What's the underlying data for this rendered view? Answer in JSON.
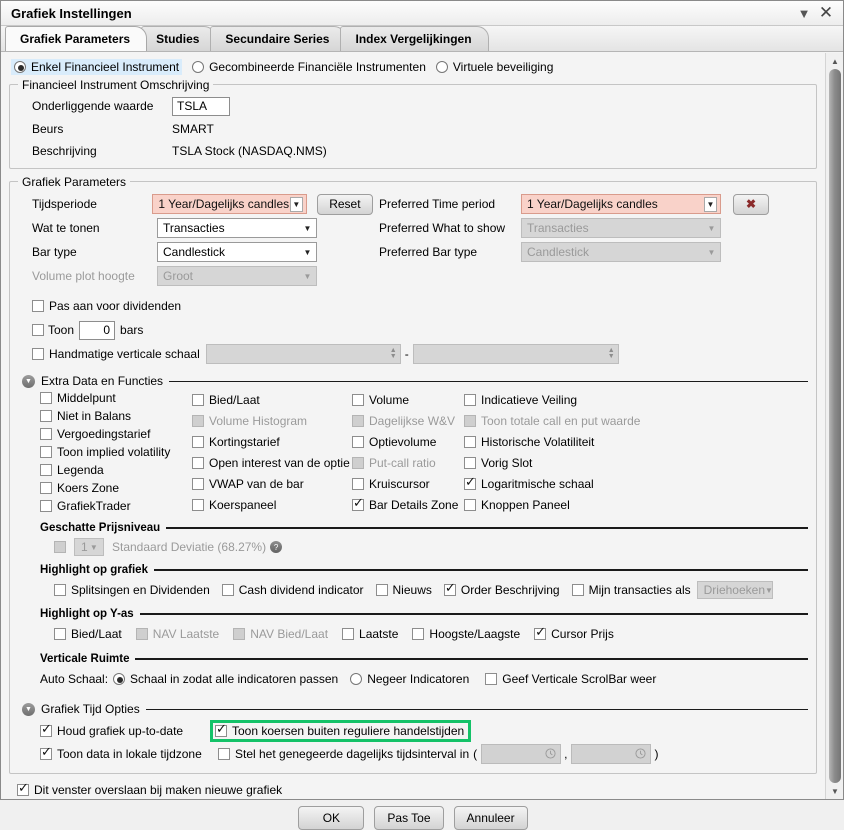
{
  "window": {
    "title": "Grafiek Instellingen",
    "minimize_icon": "chevron-down-icon",
    "close_icon": "close-icon"
  },
  "tabs": [
    {
      "label": "Grafiek Parameters",
      "active": true
    },
    {
      "label": "Studies",
      "active": false
    },
    {
      "label": "Secundaire Series",
      "active": false
    },
    {
      "label": "Index Vergelijkingen",
      "active": false
    }
  ],
  "instrument_mode": {
    "options": [
      {
        "label": "Enkel Financieel Instrument",
        "selected": true
      },
      {
        "label": "Gecombineerde Financiële Instrumenten",
        "selected": false
      },
      {
        "label": "Virtuele beveiliging",
        "selected": false
      }
    ]
  },
  "instrument_group": {
    "title": "Financieel Instrument Omschrijving",
    "underlying_label": "Onderliggende waarde",
    "underlying_value": "TSLA",
    "exchange_label": "Beurs",
    "exchange_value": "SMART",
    "description_label": "Beschrijving",
    "description_value": "TSLA Stock (NASDAQ.NMS)"
  },
  "chart_params": {
    "title": "Grafiek Parameters",
    "timeperiod_label": "Tijdsperiode",
    "timeperiod_value": "1 Year/Dagelijks candles",
    "reset_label": "Reset",
    "whattoshow_label": "Wat te tonen",
    "whattoshow_value": "Transacties",
    "bartype_label": "Bar type",
    "bartype_value": "Candlestick",
    "volumeheight_label": "Volume plot hoogte",
    "volumeheight_value": "Groot",
    "preferred_timeperiod_label": "Preferred Time period",
    "preferred_timeperiod_value": "1 Year/Dagelijks candles",
    "clear_preferred_icon": "x-icon",
    "preferred_whattoshow_label": "Preferred What to show",
    "preferred_whattoshow_value": "Transacties",
    "preferred_bartype_label": "Preferred Bar type",
    "preferred_bartype_value": "Candlestick",
    "adjust_dividends_label": "Pas aan voor dividenden",
    "show_bars_prefix": "Toon",
    "show_bars_value": "0",
    "show_bars_suffix": "bars",
    "manual_scale_label": "Handmatige verticale schaal",
    "manual_scale_separator": "-"
  },
  "extra_data": {
    "title": "Extra Data en Functies",
    "collapse_icon": "chevron-down-circle-icon",
    "columns": [
      [
        {
          "label": "Middelpunt",
          "checked": false,
          "disabled": false
        },
        {
          "label": "Niet in Balans",
          "checked": false,
          "disabled": false
        },
        {
          "label": "Vergoedingstarief",
          "checked": false,
          "disabled": false
        },
        {
          "label": "Toon implied volatility",
          "checked": false,
          "disabled": false
        },
        {
          "label": "Legenda",
          "checked": false,
          "disabled": false
        },
        {
          "label": "Koers Zone",
          "checked": false,
          "disabled": false
        },
        {
          "label": "GrafiekTrader",
          "checked": false,
          "disabled": false
        }
      ],
      [
        {
          "label": "Bied/Laat",
          "checked": false,
          "disabled": false
        },
        {
          "label": "Volume Histogram",
          "checked": false,
          "disabled": true
        },
        {
          "label": "Kortingstarief",
          "checked": false,
          "disabled": false
        },
        {
          "label": "Open interest van de optie",
          "checked": false,
          "disabled": false
        },
        {
          "label": "VWAP van de bar",
          "checked": false,
          "disabled": false
        },
        {
          "label": "Koerspaneel",
          "checked": false,
          "disabled": false
        }
      ],
      [
        {
          "label": "Volume",
          "checked": false,
          "disabled": false
        },
        {
          "label": "Dagelijkse W&V",
          "checked": false,
          "disabled": true
        },
        {
          "label": "Optievolume",
          "checked": false,
          "disabled": false
        },
        {
          "label": "Put-call ratio",
          "checked": false,
          "disabled": true
        },
        {
          "label": "Kruiscursor",
          "checked": false,
          "disabled": false
        },
        {
          "label": "Bar Details Zone",
          "checked": true,
          "disabled": false
        }
      ],
      [
        {
          "label": "Indicatieve Veiling",
          "checked": false,
          "disabled": false
        },
        {
          "label": "Toon totale call en put waarde",
          "checked": false,
          "disabled": true
        },
        {
          "label": "Historische Volatiliteit",
          "checked": false,
          "disabled": false
        },
        {
          "label": "Vorig Slot",
          "checked": false,
          "disabled": false
        },
        {
          "label": "Logaritmische schaal",
          "checked": true,
          "disabled": false
        },
        {
          "label": "Knoppen Paneel",
          "checked": false,
          "disabled": false
        }
      ]
    ]
  },
  "price_level": {
    "title": "Geschatte Prijsniveau",
    "multiplier": "1",
    "label": "Standaard Deviatie (68.27%)",
    "help_icon": "help-icon"
  },
  "highlight_chart": {
    "title": "Highlight op grafiek",
    "items": [
      {
        "label": "Splitsingen en Dividenden",
        "checked": false,
        "disabled": false
      },
      {
        "label": "Cash dividend indicator",
        "checked": false,
        "disabled": false
      },
      {
        "label": "Nieuws",
        "checked": false,
        "disabled": false
      },
      {
        "label": "Order Beschrijving",
        "checked": true,
        "disabled": false
      },
      {
        "label": "Mijn transacties als",
        "checked": false,
        "disabled": false
      }
    ],
    "transactions_marker_value": "Driehoeken"
  },
  "highlight_yaxis": {
    "title": "Highlight op Y-as",
    "items": [
      {
        "label": "Bied/Laat",
        "checked": false,
        "disabled": false
      },
      {
        "label": "NAV Laatste",
        "checked": false,
        "disabled": true
      },
      {
        "label": "NAV Bied/Laat",
        "checked": false,
        "disabled": true
      },
      {
        "label": "Laatste",
        "checked": false,
        "disabled": false
      },
      {
        "label": "Hoogste/Laagste",
        "checked": false,
        "disabled": false
      },
      {
        "label": "Cursor Prijs",
        "checked": true,
        "disabled": false
      }
    ]
  },
  "vertical_space": {
    "title": "Verticale Ruimte",
    "auto_scale_label": "Auto Schaal:",
    "radios": [
      {
        "label": "Schaal in zodat alle indicatoren passen",
        "selected": true
      },
      {
        "label": "Negeer Indicatoren",
        "selected": false
      }
    ],
    "scrollbar_label": "Geef Verticale ScrolBar weer",
    "scrollbar_checked": false
  },
  "time_options": {
    "title": "Grafiek Tijd Opties",
    "collapse_icon": "chevron-down-circle-icon",
    "keep_uptodate_label": "Houd grafiek up-to-date",
    "keep_uptodate_checked": true,
    "outside_rth_label": "Toon koersen buiten reguliere handelstijden",
    "outside_rth_checked": true,
    "outside_rth_highlight_color": "#14c268",
    "local_timezone_label": "Toon data in lokale tijdzone",
    "local_timezone_checked": true,
    "ignore_interval_label": "Stel het genegeerde dagelijks tijdsinterval in",
    "ignore_interval_checked": false,
    "interval_open_paren": "(",
    "interval_comma": ",",
    "interval_close_paren": ")",
    "interval_from": "",
    "interval_to": "",
    "clock_icon": "clock-icon"
  },
  "footer": {
    "skip_window_label": "Dit venster overslaan bij maken nieuwe grafiek",
    "skip_window_checked": true,
    "ok_label": "OK",
    "apply_label": "Pas Toe",
    "cancel_label": "Annuleer"
  }
}
